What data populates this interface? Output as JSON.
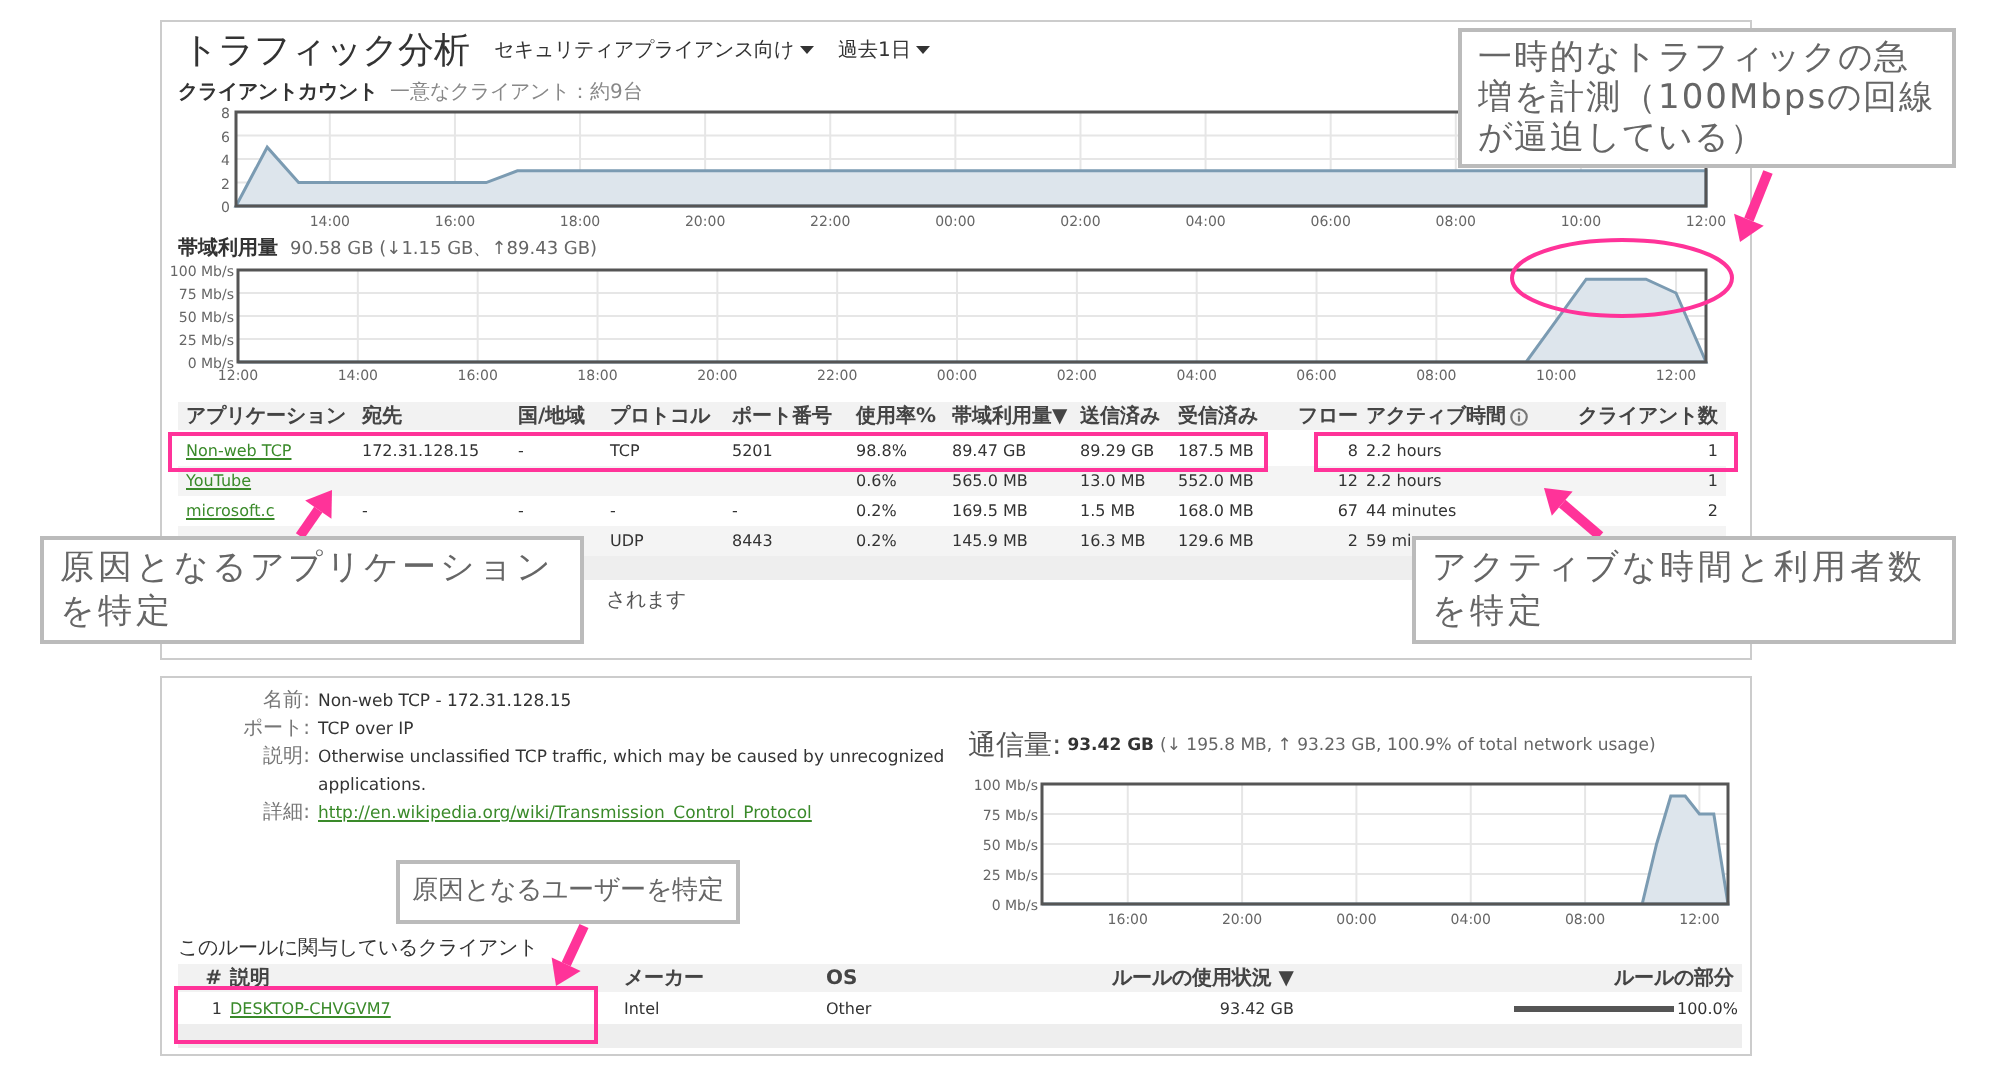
{
  "header": {
    "title": "トラフィック分析",
    "filters": [
      {
        "label": "セキュリティアプライアンス向け"
      },
      {
        "label": "過去1日"
      }
    ]
  },
  "client_count": {
    "title": "クライアントカウント",
    "subtitle": "一意なクライアント：約9台",
    "chart_data": {
      "type": "area",
      "categories": [
        null,
        null,
        null,
        "14:00",
        null,
        null,
        null,
        "16:00",
        null,
        null,
        null,
        "18:00",
        null,
        null,
        null,
        "20:00",
        null,
        null,
        null,
        "22:00",
        null,
        null,
        null,
        "00:00",
        null,
        null,
        null,
        "02:00",
        null,
        null,
        null,
        "04:00",
        null,
        null,
        null,
        "06:00",
        null,
        null,
        null,
        "08:00",
        null,
        null,
        null,
        "10:00",
        null,
        null,
        null,
        "12:00"
      ],
      "series": [
        {
          "color": "#7b9bb2",
          "values": [
            0,
            5,
            2,
            2,
            2,
            2,
            2,
            2,
            2,
            3,
            3,
            3,
            3,
            3,
            3,
            3,
            3,
            3,
            3,
            3,
            3,
            3,
            3,
            3,
            3,
            3,
            3,
            3,
            3,
            3,
            3,
            3,
            3,
            3,
            3,
            3,
            3,
            3,
            3,
            3,
            3,
            3,
            3,
            3,
            3,
            3,
            3,
            3
          ]
        }
      ],
      "ylim": [
        0,
        8
      ],
      "yticks": [
        0,
        2,
        4,
        6,
        8
      ],
      "grid": true
    }
  },
  "bandwidth": {
    "title": "帯域利用量",
    "summary": "90.58 GB (↓1.15 GB、↑89.43 GB)",
    "chart_data": {
      "type": "area",
      "categories": [
        "12:00",
        null,
        null,
        null,
        "14:00",
        null,
        null,
        null,
        "16:00",
        null,
        null,
        null,
        "18:00",
        null,
        null,
        null,
        "20:00",
        null,
        null,
        null,
        "22:00",
        null,
        null,
        null,
        "00:00",
        null,
        null,
        null,
        "02:00",
        null,
        null,
        null,
        "04:00",
        null,
        null,
        null,
        "06:00",
        null,
        null,
        null,
        "08:00",
        null,
        null,
        null,
        "10:00",
        null,
        null,
        null,
        "12:00",
        null
      ],
      "series": [
        {
          "color": "#7b9bb2",
          "values": [
            0,
            0,
            0,
            0,
            0,
            0,
            0,
            0,
            0,
            0,
            0,
            0,
            0,
            0,
            0,
            0,
            0,
            0,
            0,
            0,
            0,
            0,
            0,
            0,
            0,
            0,
            0,
            0,
            0,
            0,
            0,
            0,
            0,
            0,
            0,
            0,
            0,
            0,
            0,
            0,
            0,
            0,
            0,
            0,
            45,
            90,
            90,
            90,
            75,
            0
          ]
        }
      ],
      "ylim": [
        0,
        100
      ],
      "yticks": [
        {
          "value": 0,
          "label": "0 Mb/s"
        },
        {
          "value": 25,
          "label": "25 Mb/s"
        },
        {
          "value": 50,
          "label": "50 Mb/s"
        },
        {
          "value": 75,
          "label": "75 Mb/s"
        },
        {
          "value": 100,
          "label": "100 Mb/s"
        }
      ],
      "grid": true
    }
  },
  "app_table": {
    "columns": [
      "アプリケーション",
      "宛先",
      "国/地域",
      "プロトコル",
      "ポート番号",
      "使用率%",
      "帯域利用量▼",
      "送信済み",
      "受信済み",
      "フロー",
      "アクティブ時間",
      "クライアント数"
    ],
    "rows": [
      {
        "cells": [
          "Non-web TCP",
          "172.31.128.15",
          "-",
          "TCP",
          "5201",
          "98.8%",
          "89.47 GB",
          "89.29 GB",
          "187.5 MB",
          "8",
          "2.2 hours",
          "1"
        ]
      },
      {
        "cells": [
          "YouTube",
          null,
          null,
          null,
          null,
          "0.6%",
          "565.0 MB",
          "13.0 MB",
          "552.0 MB",
          "12",
          "2.2 hours",
          "1"
        ]
      },
      {
        "cells": [
          "microsoft.c",
          "-",
          "-",
          "-",
          "-",
          "0.2%",
          "169.5 MB",
          "1.5 MB",
          "168.0 MB",
          "67",
          "44 minutes",
          "2"
        ]
      },
      {
        "cells": [
          null,
          null,
          null,
          "UDP",
          "8443",
          "0.2%",
          "145.9 MB",
          "16.3 MB",
          "129.6 MB",
          "2",
          "59 mi",
          null
        ]
      }
    ],
    "note": "されます"
  },
  "detail": {
    "fields": [
      {
        "label": "名前:",
        "value": "Non-web TCP - 172.31.128.15",
        "kind": "text"
      },
      {
        "label": "ポート:",
        "value": "TCP over IP",
        "kind": "text"
      },
      {
        "label": "説明:",
        "value": "Otherwise unclassified TCP traffic, which may be caused by unrecognized applications.",
        "kind": "text"
      },
      {
        "label": "詳細:",
        "value": "http://en.wikipedia.org/wiki/Transmission_Control_Protocol",
        "kind": "link"
      }
    ],
    "usage": {
      "title": "通信量:",
      "total": "93.42 GB",
      "summary": "(↓ 195.8 MB, ↑ 93.23 GB, 100.9% of total network usage)",
      "chart_data": {
        "type": "area",
        "categories": [
          null,
          null,
          null,
          null,
          null,
          null,
          "16:00",
          null,
          null,
          null,
          null,
          null,
          null,
          null,
          "20:00",
          null,
          null,
          null,
          null,
          null,
          null,
          null,
          "00:00",
          null,
          null,
          null,
          null,
          null,
          null,
          null,
          "04:00",
          null,
          null,
          null,
          null,
          null,
          null,
          null,
          "08:00",
          null,
          null,
          null,
          null,
          null,
          null,
          null,
          "12:00",
          null,
          null
        ],
        "series": [
          {
            "color": "#7b9bb2",
            "values": [
              0,
              0,
              0,
              0,
              0,
              0,
              0,
              0,
              0,
              0,
              0,
              0,
              0,
              0,
              0,
              0,
              0,
              0,
              0,
              0,
              0,
              0,
              0,
              0,
              0,
              0,
              0,
              0,
              0,
              0,
              0,
              0,
              0,
              0,
              0,
              0,
              0,
              0,
              0,
              0,
              0,
              0,
              0,
              50,
              90,
              90,
              75,
              75,
              0
            ]
          }
        ],
        "ylim": [
          0,
          100
        ],
        "yticks": [
          {
            "value": 0,
            "label": "0 Mb/s"
          },
          {
            "value": 25,
            "label": "25 Mb/s"
          },
          {
            "value": 50,
            "label": "50 Mb/s"
          },
          {
            "value": 75,
            "label": "75 Mb/s"
          },
          {
            "value": 100,
            "label": "100 Mb/s"
          }
        ],
        "grid": true
      }
    }
  },
  "clients": {
    "title": "このルールに関与しているクライアント",
    "columns": [
      "#",
      "説明",
      "メーカー",
      "OS",
      "ルールの使用状況 ▼",
      "ルールの部分"
    ],
    "rows": [
      {
        "cells": [
          "1",
          "DESKTOP-CHVGVM7",
          "Intel",
          "Other",
          "93.42 GB"
        ],
        "level": 1.0,
        "share": "100.0%"
      }
    ]
  },
  "annotations": [
    {
      "text": "一時的なトラフィックの急増を計測（100Mbpsの回線が逼迫している）"
    },
    {
      "text": "原因となるアプリケーションを特定"
    },
    {
      "text": "アクティブな時間と利用者数を特定"
    },
    {
      "text": "原因となるユーザーを特定"
    }
  ]
}
